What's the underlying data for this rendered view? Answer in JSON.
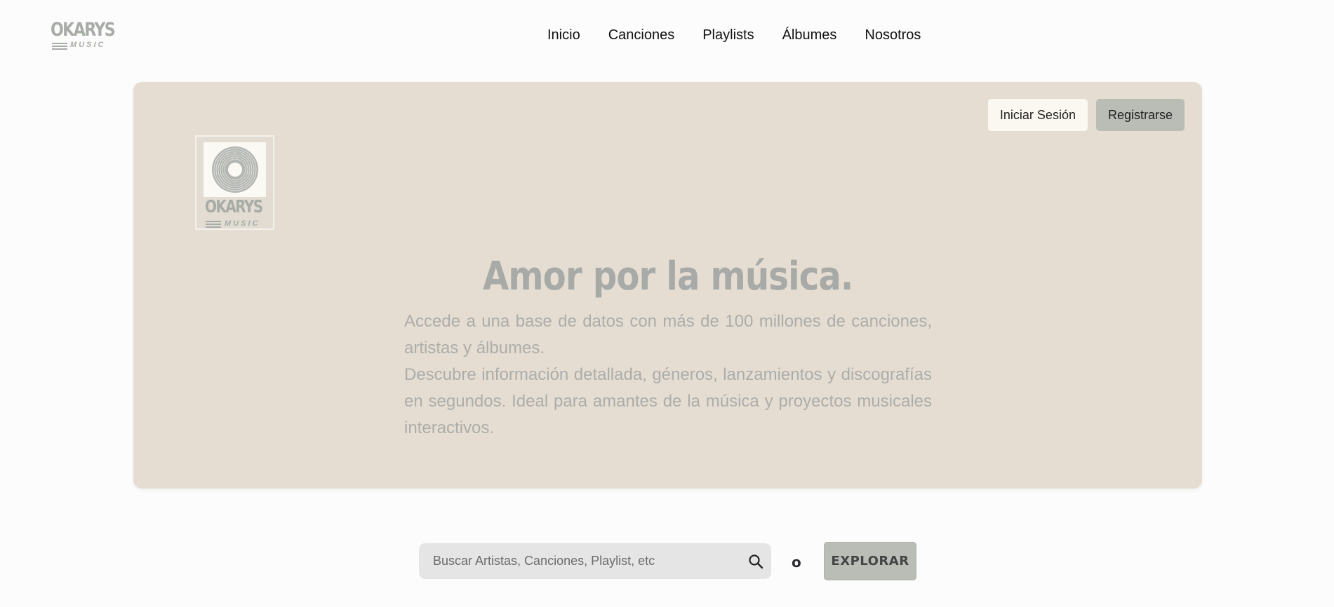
{
  "brand": {
    "name": "OKARYS",
    "tagline": "MUSIC"
  },
  "nav": {
    "items": [
      {
        "label": "Inicio"
      },
      {
        "label": "Canciones"
      },
      {
        "label": "Playlists"
      },
      {
        "label": "Álbumes"
      },
      {
        "label": "Nosotros"
      }
    ]
  },
  "hero": {
    "login_label": "Iniciar Sesión",
    "register_label": "Registrarse",
    "title": "Amor por la música.",
    "paragraph_1": "Accede a una base de datos con más de 100 millones de canciones, artistas y álbumes.",
    "paragraph_2": "Descubre información detallada, géneros, lanzamientos y discografías en segundos. Ideal para amantes de la música y proyectos musicales interactivos.",
    "colors": {
      "panel": "#e5ddd2",
      "muted_text": "#acadaa"
    }
  },
  "search": {
    "placeholder": "Buscar Artistas, Canciones, Playlist, etc",
    "value": "",
    "icon": "search-icon",
    "or_text": "o",
    "explore_label": "EXPLORAR"
  }
}
